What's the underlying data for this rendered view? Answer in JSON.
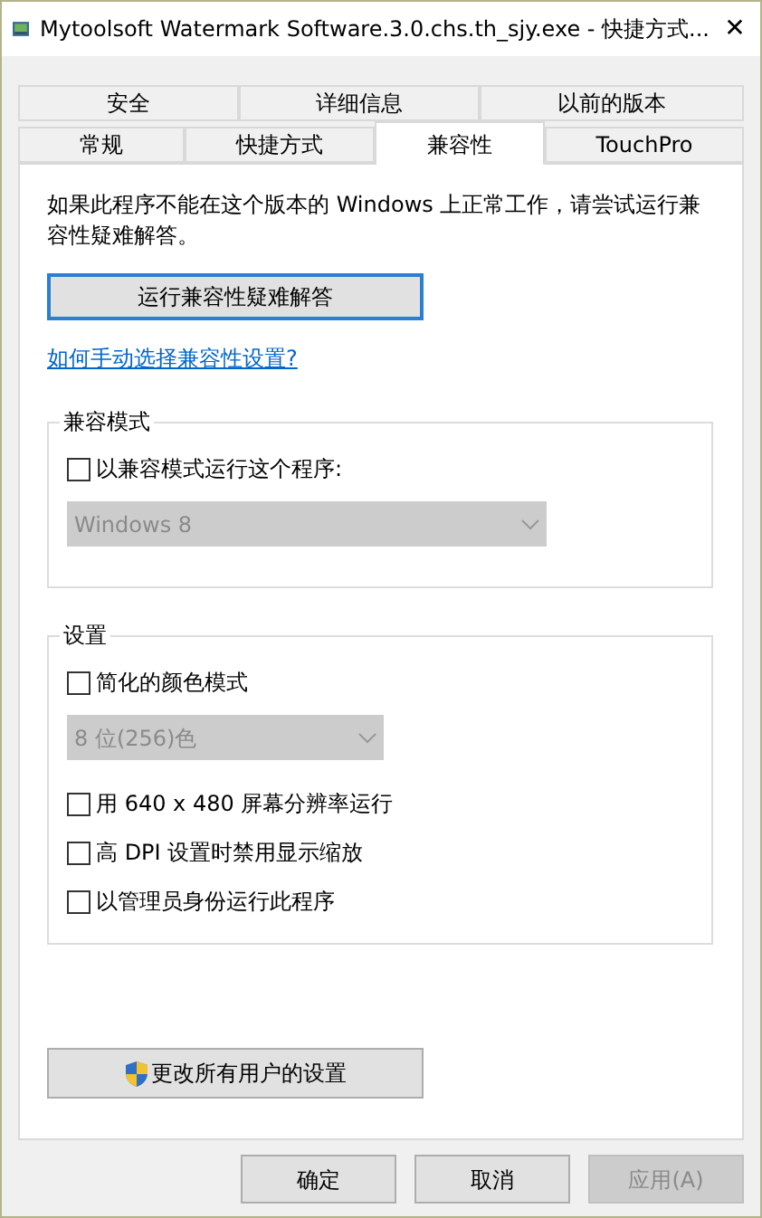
{
  "window": {
    "title": "Mytoolsoft Watermark Software.3.0.chs.th_sjy.exe - 快捷方式...",
    "close": "✕"
  },
  "tab_rows": [
    [
      {
        "label": "安全",
        "selected": false
      },
      {
        "label": "详细信息",
        "selected": false
      },
      {
        "label": "以前的版本",
        "selected": false
      }
    ],
    [
      {
        "label": "常规",
        "selected": false
      },
      {
        "label": "快捷方式",
        "selected": false
      },
      {
        "label": "兼容性",
        "selected": true
      },
      {
        "label": "TouchPro",
        "selected": false
      }
    ]
  ],
  "intro": "如果此程序不能在这个版本的 Windows 上正常工作，请尝试运行兼容性疑难解答。",
  "troubleshoot_button": "运行兼容性疑难解答",
  "help_link": "如何手动选择兼容性设置?",
  "groups": [
    {
      "title": "兼容模式",
      "items": [
        {
          "kind": "checkbox",
          "label": "以兼容模式运行这个程序:",
          "checked": false
        },
        {
          "kind": "dropdown",
          "value": "Windows 8",
          "disabled": true
        }
      ]
    },
    {
      "title": "设置",
      "items": [
        {
          "kind": "checkbox",
          "label": "简化的颜色模式",
          "checked": false
        },
        {
          "kind": "dropdown",
          "value": "8 位(256)色",
          "disabled": true
        },
        {
          "kind": "checkbox",
          "label": "用 640 x 480 屏幕分辨率运行",
          "checked": false
        },
        {
          "kind": "checkbox",
          "label": "高 DPI 设置时禁用显示缩放",
          "checked": false
        },
        {
          "kind": "checkbox",
          "label": "以管理员身份运行此程序",
          "checked": false
        }
      ]
    }
  ],
  "all_users_button": "更改所有用户的设置",
  "footer_buttons": [
    {
      "label": "确定",
      "disabled": false
    },
    {
      "label": "取消",
      "disabled": false
    },
    {
      "label": "应用(A)",
      "disabled": true
    }
  ]
}
